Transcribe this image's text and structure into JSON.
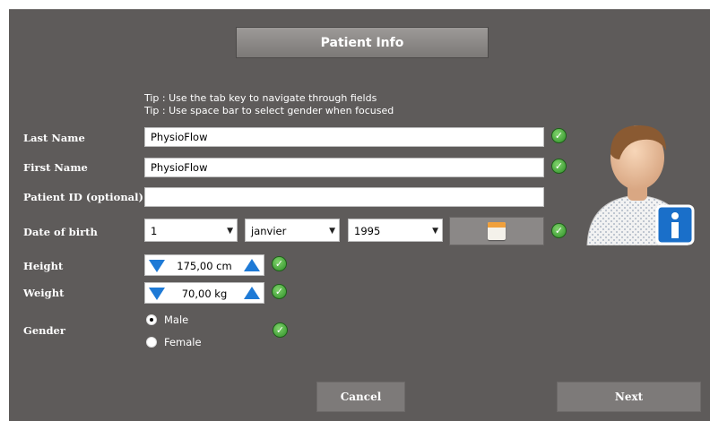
{
  "header": {
    "title": "Patient Info"
  },
  "tips": [
    "Tip : Use the tab key to navigate through fields",
    "Tip : Use space bar to select gender when focused"
  ],
  "fields": {
    "last_name": {
      "label": "Last Name",
      "value": "PhysioFlow"
    },
    "first_name": {
      "label": "First Name",
      "value": "PhysioFlow"
    },
    "patient_id": {
      "label": "Patient ID  (optional)",
      "value": ""
    },
    "dob": {
      "label": "Date of birth",
      "day": "1",
      "month": "janvier",
      "year": "1995"
    },
    "height": {
      "label": "Height",
      "value": "175,00 cm"
    },
    "weight": {
      "label": "Weight",
      "value": "70,00 kg"
    },
    "gender": {
      "label": "Gender",
      "options": [
        "Male",
        "Female"
      ],
      "selected": "Male"
    }
  },
  "buttons": {
    "cancel": "Cancel",
    "next": "Next"
  },
  "colors": {
    "background": "#5e5b5a",
    "check": "#2f8f28",
    "stepper_arrow": "#1e7ad6",
    "info_badge": "#1a6fc9"
  },
  "icons": [
    "check-icon",
    "calendar-icon",
    "arrow-down-icon",
    "arrow-up-icon",
    "patient-avatar-icon",
    "info-icon"
  ]
}
